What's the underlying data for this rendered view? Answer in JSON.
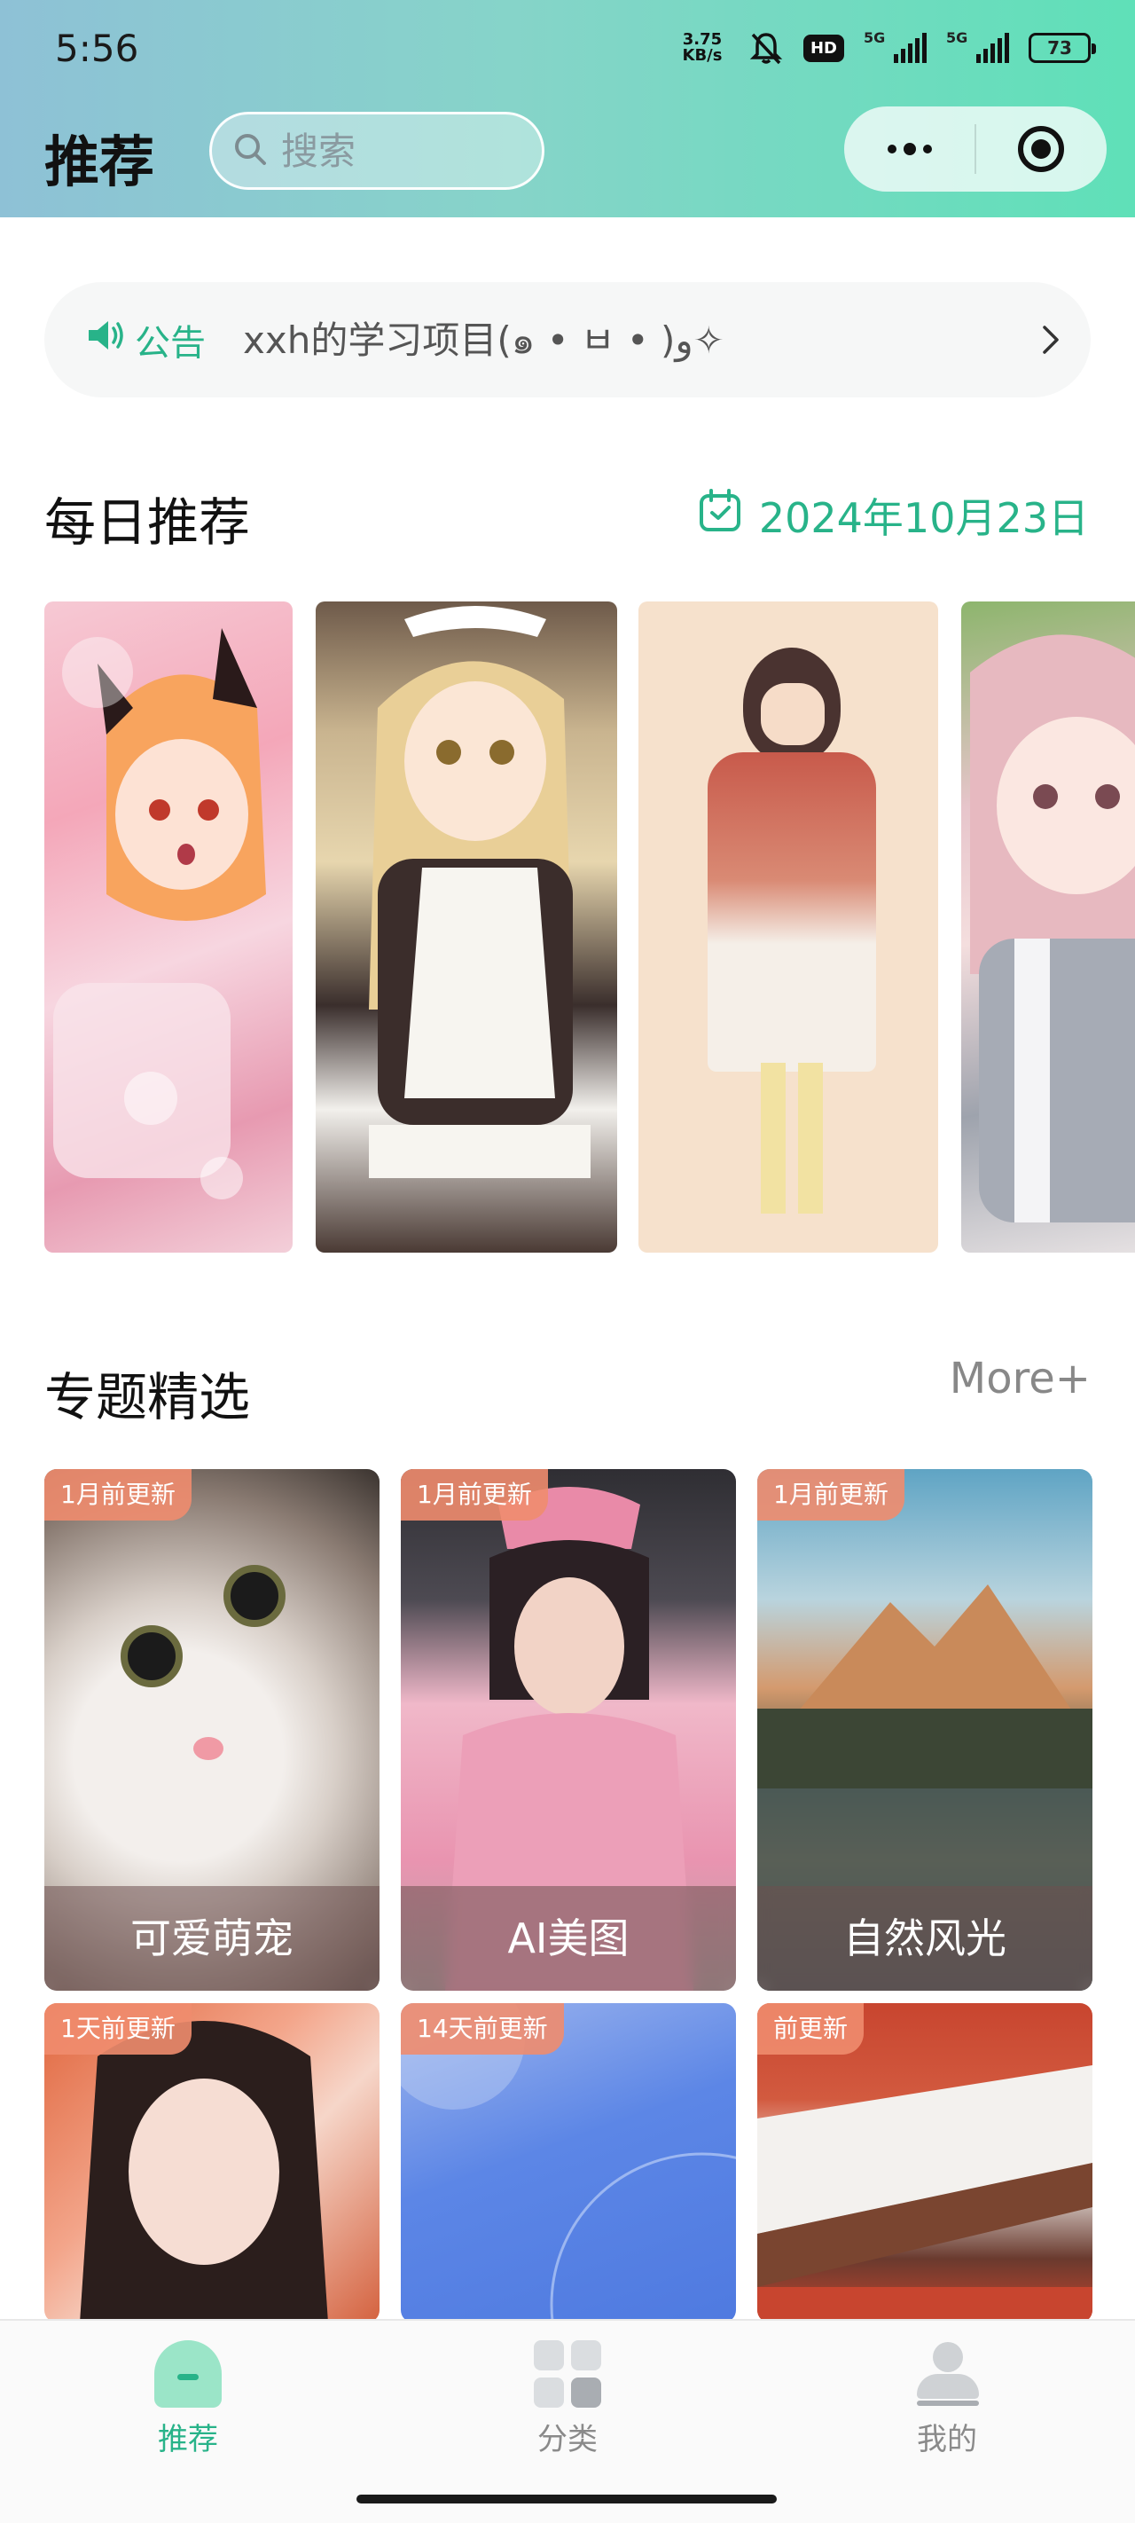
{
  "status_bar": {
    "time": "5:56",
    "net_speed": "3.75 KB/s",
    "hd": "HD",
    "sim1": "5G",
    "sim2": "5G",
    "battery": "73"
  },
  "header": {
    "title": "推荐",
    "search_placeholder": "搜索",
    "accent": "#28b389"
  },
  "notice": {
    "tag": "公告",
    "text": "xxh的学习项目(๑ • ㅂ • )و✧"
  },
  "daily": {
    "title": "每日推荐",
    "date": "2024年10月23日",
    "wallpapers": [
      "anime-fox-girl-sakura",
      "anime-maid-girl",
      "anime-girl-red-scarf",
      "anime-girl-pink-hair"
    ]
  },
  "topics": {
    "title": "专题精选",
    "more": "More+",
    "items": [
      {
        "badge": "1月前更新",
        "name": "可爱萌宠"
      },
      {
        "badge": "1月前更新",
        "name": "AI美图"
      },
      {
        "badge": "1月前更新",
        "name": "自然风光"
      },
      {
        "badge": "1天前更新",
        "name": ""
      },
      {
        "badge": "14天前更新",
        "name": ""
      },
      {
        "badge": "前更新",
        "name": ""
      }
    ]
  },
  "tabbar": {
    "items": [
      {
        "label": "推荐",
        "icon": "home-icon",
        "active": true
      },
      {
        "label": "分类",
        "icon": "grid-icon",
        "active": false
      },
      {
        "label": "我的",
        "icon": "user-icon",
        "active": false
      }
    ]
  }
}
